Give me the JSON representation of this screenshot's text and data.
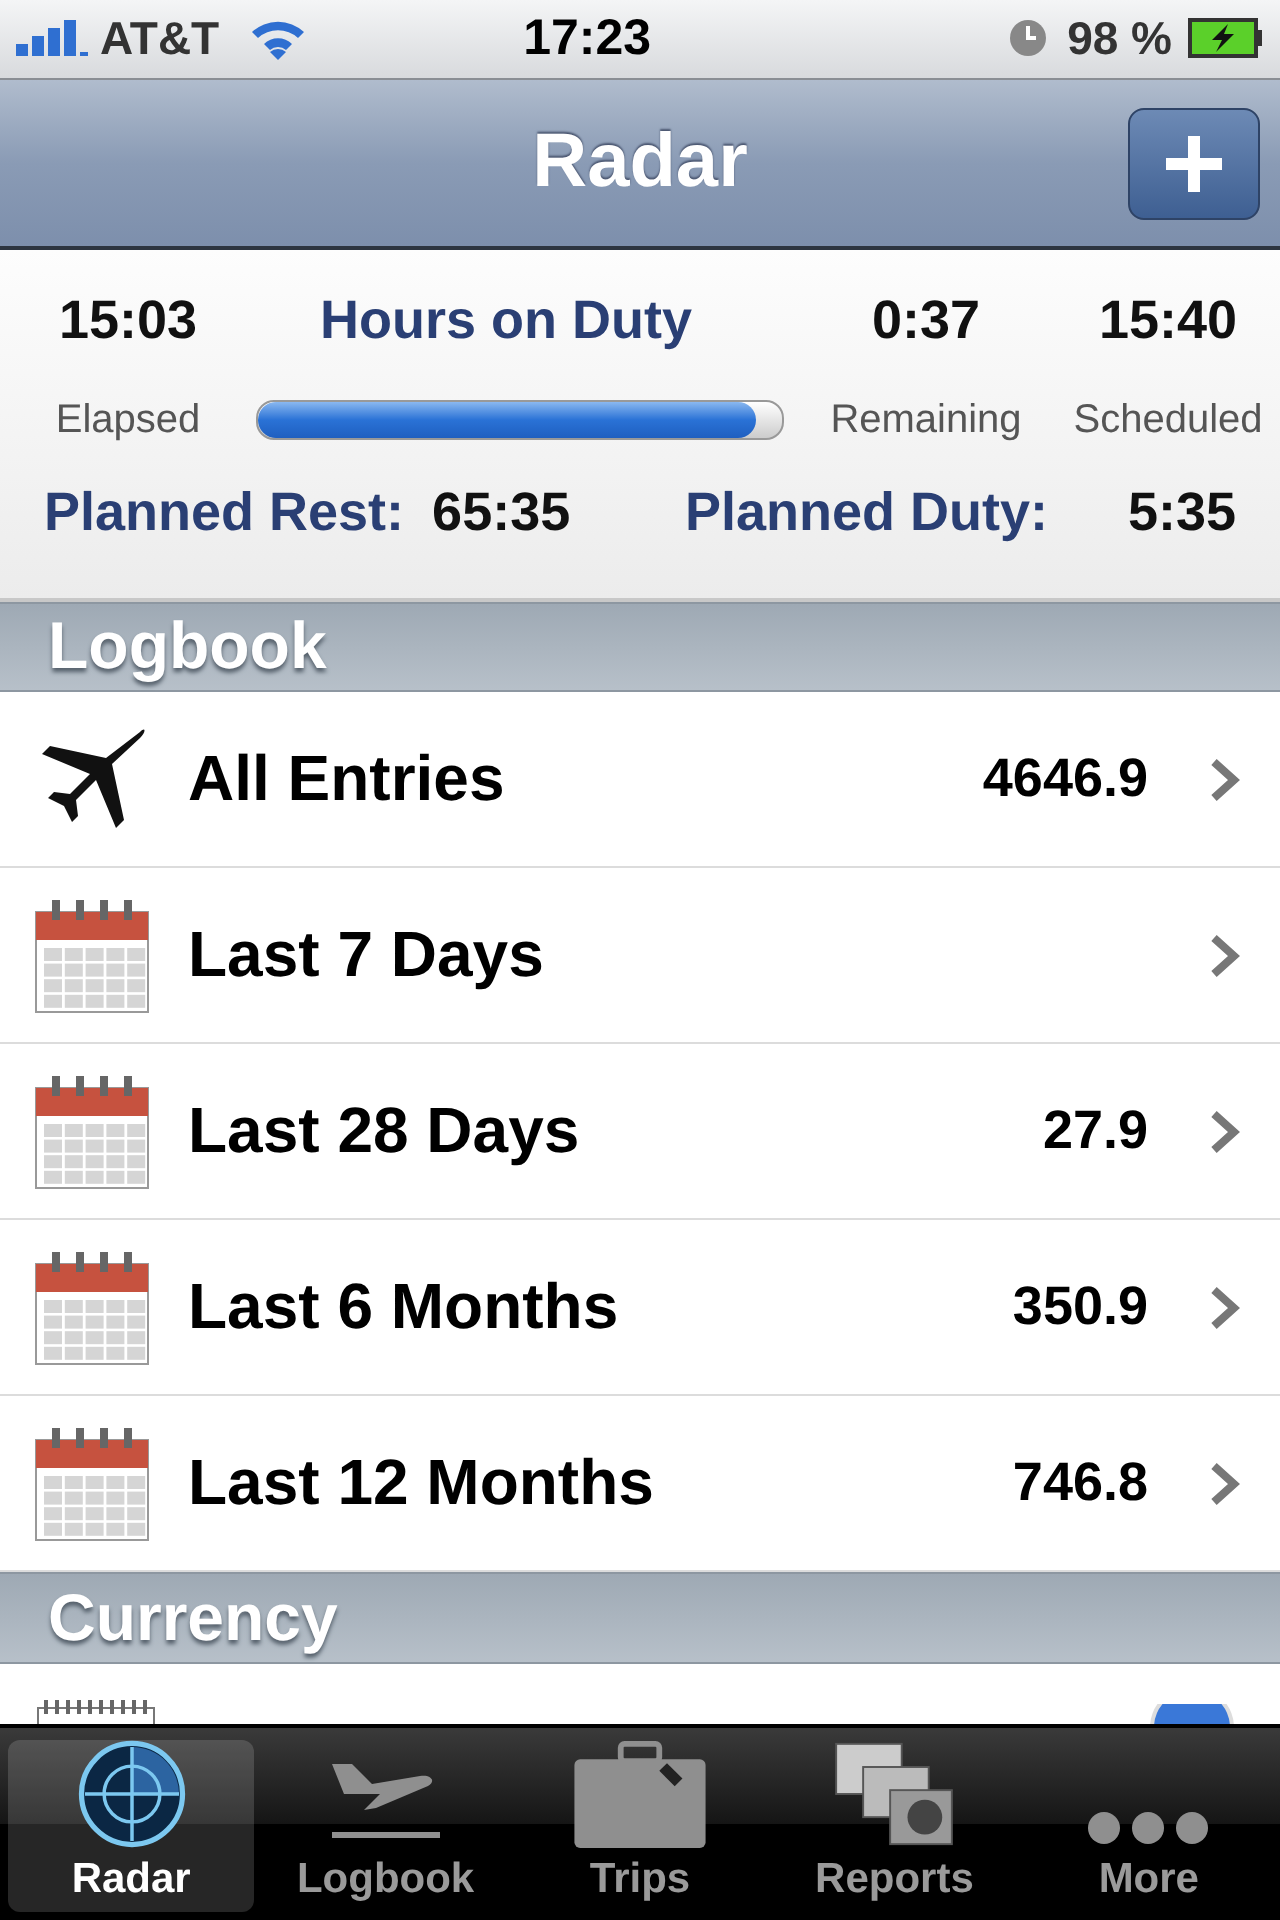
{
  "status_bar": {
    "carrier": "AT&T",
    "time": "17:23",
    "battery": "98 %"
  },
  "nav": {
    "title": "Radar"
  },
  "duty": {
    "elapsed": "15:03",
    "elapsed_label": "Elapsed",
    "title": "Hours on Duty",
    "level": 0.95,
    "remaining": "0:37",
    "remaining_label": "Remaining",
    "scheduled": "15:40",
    "scheduled_label": "Scheduled",
    "rest_label": "Planned Rest:",
    "rest_value": "65:35",
    "planned_duty_label": "Planned Duty:",
    "planned_duty_value": "5:35"
  },
  "sections": [
    {
      "title": "Logbook",
      "rows": [
        {
          "kind": "plane",
          "label": "All Entries",
          "value": "4646.9"
        },
        {
          "kind": "calendar",
          "label": "Last 7 Days"
        },
        {
          "kind": "calendar",
          "label": "Last 28 Days",
          "value": "27.9"
        },
        {
          "kind": "calendar",
          "label": "Last 6 Months",
          "value": "350.9"
        },
        {
          "kind": "calendar",
          "label": "Last 12 Months",
          "value": "746.8"
        }
      ]
    },
    {
      "title": "Currency"
    }
  ],
  "tabs": [
    {
      "label": "Radar",
      "selected": true,
      "kind": "radar"
    },
    {
      "label": "Logbook",
      "selected": false,
      "kind": "plane"
    },
    {
      "label": "Trips",
      "selected": false,
      "kind": "case"
    },
    {
      "label": "Reports",
      "selected": false,
      "kind": "reports"
    },
    {
      "label": "More",
      "selected": false,
      "kind": "more"
    }
  ]
}
